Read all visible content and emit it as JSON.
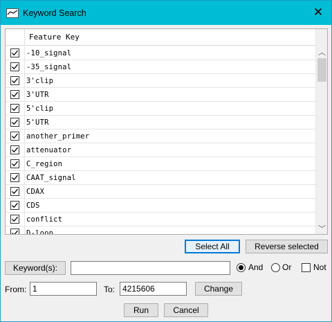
{
  "window": {
    "title": "Keyword Search",
    "close_icon": "close-icon",
    "accent": "#00bcd4"
  },
  "list": {
    "header": "Feature Key",
    "items": [
      {
        "label": "-10_signal",
        "checked": true
      },
      {
        "label": "-35_signal",
        "checked": true
      },
      {
        "label": "3'clip",
        "checked": true
      },
      {
        "label": "3'UTR",
        "checked": true
      },
      {
        "label": "5'clip",
        "checked": true
      },
      {
        "label": "5'UTR",
        "checked": true
      },
      {
        "label": "another_primer",
        "checked": true
      },
      {
        "label": "attenuator",
        "checked": true
      },
      {
        "label": "C_region",
        "checked": true
      },
      {
        "label": "CAAT_signal",
        "checked": true
      },
      {
        "label": "CDAX",
        "checked": true
      },
      {
        "label": "CDS",
        "checked": true
      },
      {
        "label": "conflict",
        "checked": true
      },
      {
        "label": "D-loop",
        "checked": true
      }
    ]
  },
  "buttons": {
    "select_all": "Select All",
    "reverse_selected": "Reverse selected",
    "keywords": "Keyword(s):",
    "change": "Change",
    "run": "Run",
    "cancel": "Cancel"
  },
  "keyword": {
    "value": "",
    "and_label": "And",
    "or_label": "Or",
    "not_label": "Not",
    "mode": "And",
    "not_checked": false
  },
  "range": {
    "from_label": "From:",
    "from_value": "1",
    "to_label": "To:",
    "to_value": "4215606"
  }
}
